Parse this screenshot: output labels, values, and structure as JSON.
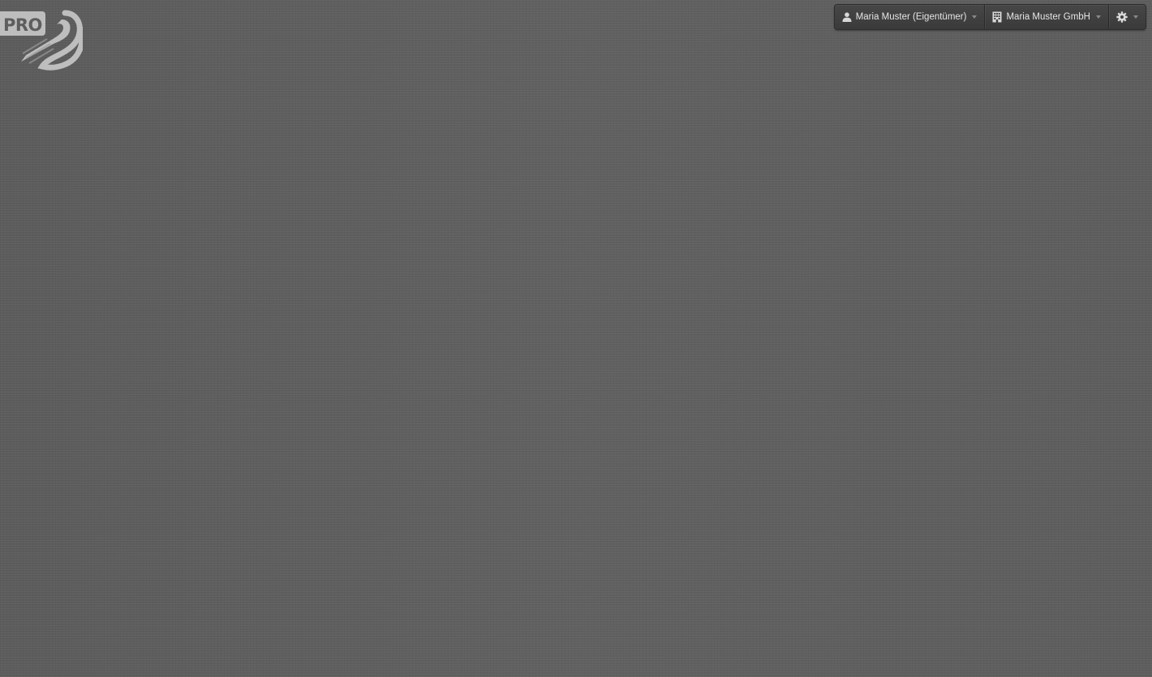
{
  "logo": {
    "text": "PRO",
    "icon": "swan-logo-icon"
  },
  "topbar": {
    "user": {
      "icon": "user-icon",
      "label": "Maria Muster (Eigentümer)"
    },
    "company": {
      "icon": "building-icon",
      "label": "Maria Muster GmbH"
    },
    "settings": {
      "icon": "gear-icon"
    }
  },
  "colors": {
    "background": "#5e5e5e",
    "toolbar": "#404040",
    "toolbar_text": "#e6e6e6",
    "logo": "#cfcfcf"
  }
}
